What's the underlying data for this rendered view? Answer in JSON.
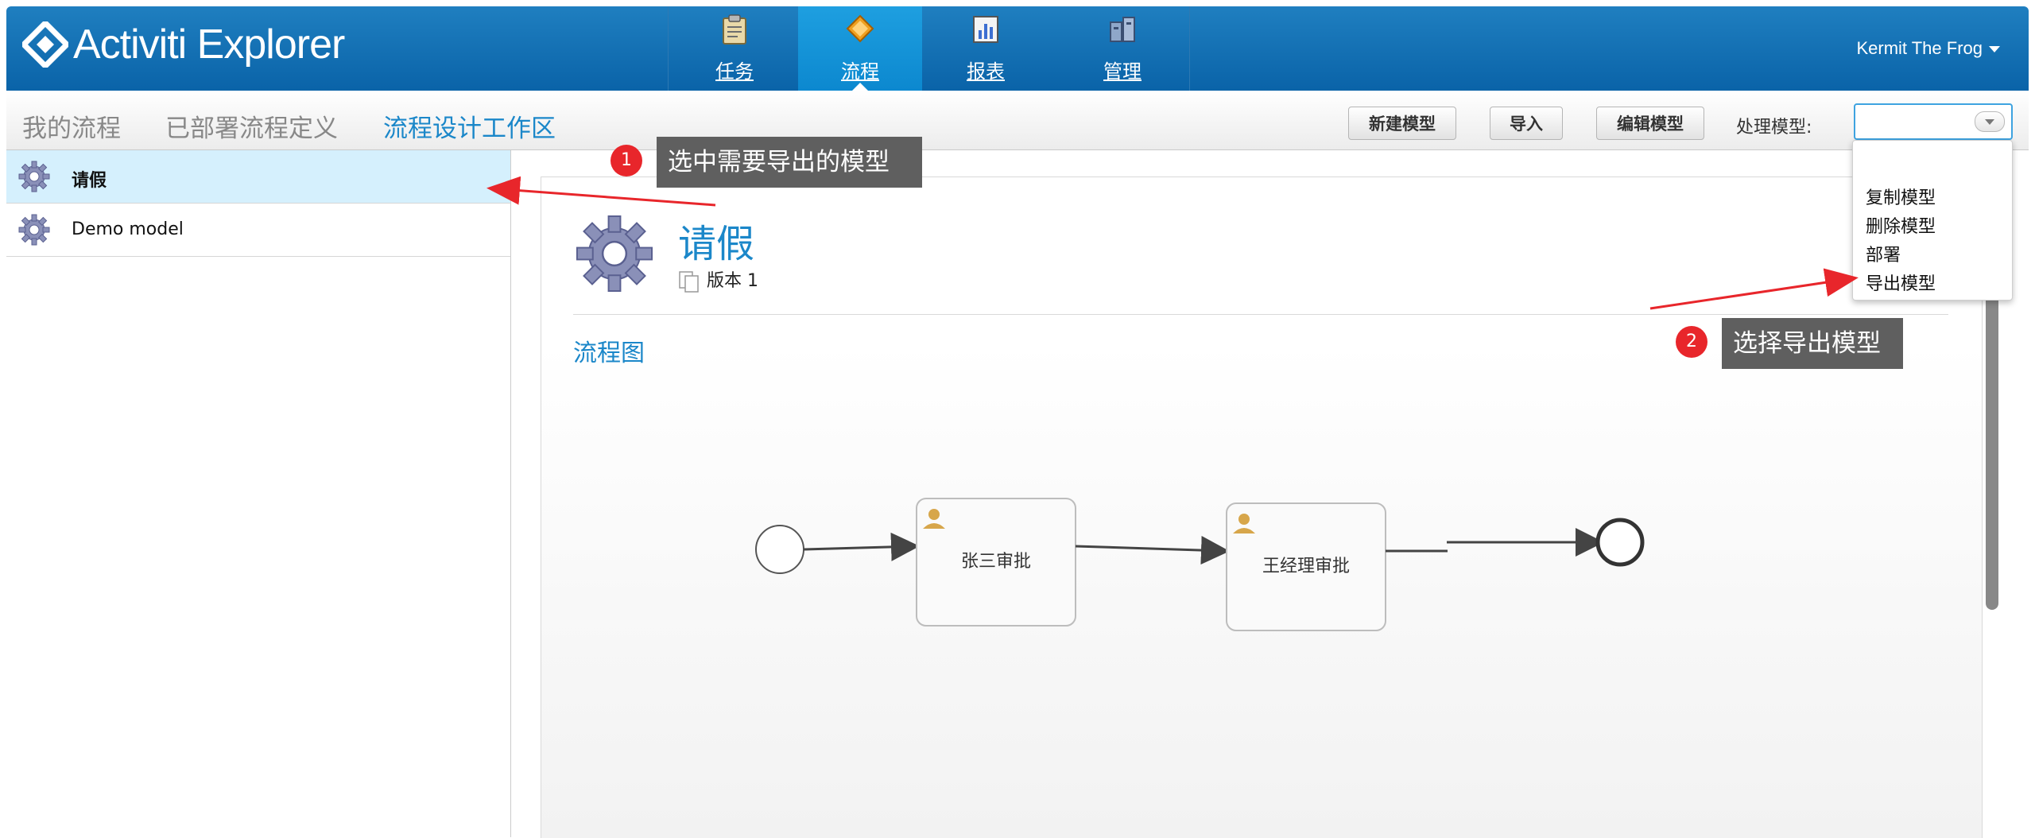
{
  "app": {
    "title": "Activiti Explorer"
  },
  "header": {
    "nav": [
      {
        "label": "任务",
        "icon": "clipboard-icon",
        "active": false
      },
      {
        "label": "流程",
        "icon": "process-diamond-icon",
        "active": true
      },
      {
        "label": "报表",
        "icon": "report-chart-icon",
        "active": false
      },
      {
        "label": "管理",
        "icon": "admin-cabinet-icon",
        "active": false
      }
    ],
    "user": "Kermit The Frog"
  },
  "toolbar": {
    "tabs": [
      "我的流程",
      "已部署流程定义",
      "流程设计工作区"
    ],
    "active_tab": "流程设计工作区",
    "buttons": {
      "new_model": "新建模型",
      "import": "导入",
      "edit_model": "编辑模型"
    },
    "process_label": "处理模型:",
    "process_value": ""
  },
  "models": [
    {
      "name": "请假",
      "selected": true
    },
    {
      "name": "Demo model",
      "selected": false
    }
  ],
  "detail": {
    "title": "请假",
    "version": "版本 1",
    "diagram_title": "流程图",
    "tasks": [
      "张三审批",
      "王经理审批"
    ]
  },
  "dropdown": {
    "options": [
      "复制模型",
      "删除模型",
      "部署",
      "导出模型"
    ]
  },
  "annotations": [
    {
      "number": "1",
      "text": "选中需要导出的模型"
    },
    {
      "number": "2",
      "text": "选择导出模型"
    }
  ],
  "colors": {
    "header": "#0a63a8",
    "accent": "#1b87c9",
    "selected_row": "#d5f0fd",
    "annotation_red": "#e8262b",
    "callout_bg": "#5f5f5f"
  }
}
